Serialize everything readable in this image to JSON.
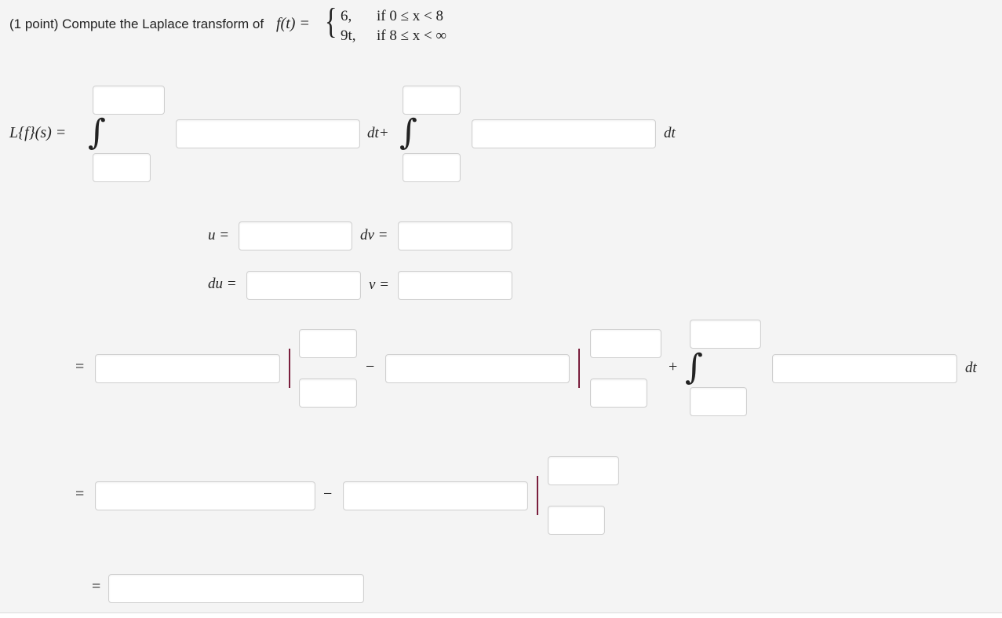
{
  "problem": {
    "prefix": "(1 point) Compute the Laplace transform of",
    "func_lhs": "f(t) =",
    "brace": "{",
    "cases": [
      {
        "expr": "6,",
        "cond": "if 0 ≤ x < 8"
      },
      {
        "expr": "9t,",
        "cond": "if 8 ≤ x < ∞"
      }
    ]
  },
  "row1": {
    "lhs": "L{f}(s) =",
    "integral": "∫",
    "dt_plus": "dt+",
    "dt": "dt"
  },
  "parts": {
    "u": "u =",
    "dv": "dv =",
    "du": "du =",
    "v": "v ="
  },
  "row3": {
    "eq": "=",
    "minus": "−",
    "plus": "+",
    "integral": "∫",
    "dt": "dt"
  },
  "row4": {
    "eq": "=",
    "minus": "−"
  },
  "row5": {
    "eq": "="
  },
  "colors": {
    "eval_bar": "#7a1f3d",
    "panel_bg": "#f4f4f4",
    "input_border": "#cfcfcf"
  }
}
